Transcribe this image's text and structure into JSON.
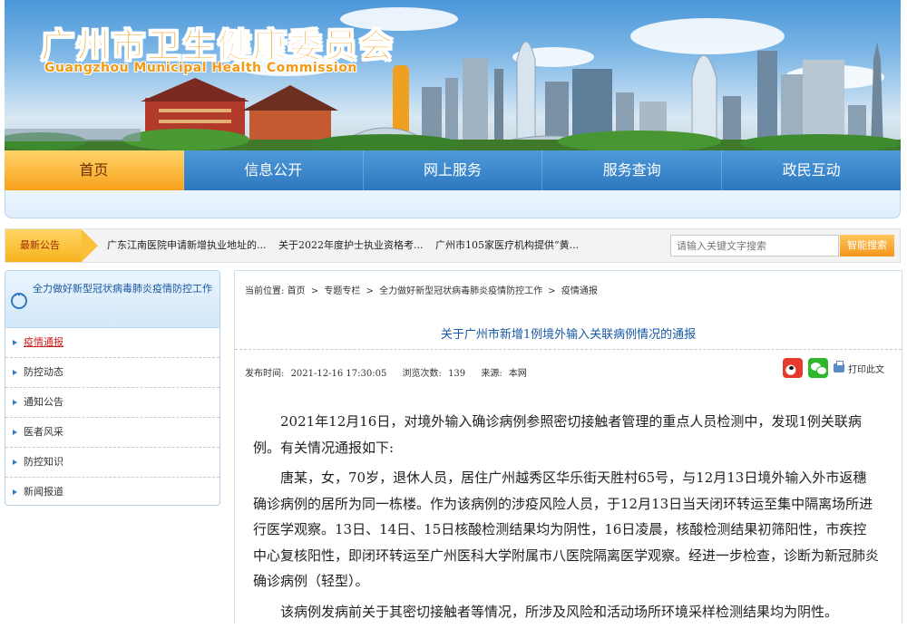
{
  "header": {
    "title_cn": "广州市卫生健康委员会",
    "title_en": "Guangzhou Municipal Health Commission"
  },
  "nav": {
    "items": [
      "首页",
      "信息公开",
      "网上服务",
      "服务查询",
      "政民互动"
    ],
    "active": "首页"
  },
  "notice": {
    "label": "最新公告",
    "links": [
      "广东江南医院申请新增执业地址的...",
      "关于2022年度护士执业资格考...",
      "广州市105家医疗机构提供“黄..."
    ]
  },
  "search": {
    "placeholder": "请输入关键文字搜索",
    "button": "智能搜索"
  },
  "sidebar": {
    "title": "全力做好新型冠状病毒肺炎疫情防控工作",
    "items": [
      "疫情通报",
      "防控动态",
      "通知公告",
      "医者风采",
      "防控知识",
      "新闻报道"
    ],
    "active": "疫情通报"
  },
  "breadcrumb": {
    "prefix": "当前位置:",
    "items": [
      "首页",
      "专题专栏",
      "全力做好新型冠状病毒肺炎疫情防控工作",
      "疫情通报"
    ],
    "separator": ">"
  },
  "article": {
    "title": "关于广州市新增1例境外输入关联病例情况的通报",
    "publish_label": "发布时间:",
    "publish_time": "2021-12-16 17:30:05",
    "views_label": "浏览次数:",
    "views": "139",
    "source_label": "来源:",
    "source": "本网",
    "print_label": "打印此文",
    "paragraphs": [
      "2021年12月16日，对境外输入确诊病例参照密切接触者管理的重点人员检测中，发现1例关联病例。有关情况通报如下:",
      "唐某，女，70岁，退休人员，居住广州越秀区华乐街天胜村65号，与12月13日境外输入外市返穗确诊病例的居所为同一栋楼。作为该病例的涉疫风险人员，于12月13日当天闭环转运至集中隔离场所进行医学观察。13日、14日、15日核酸检测结果均为阴性，16日凌晨，核酸检测结果初筛阳性，市疾控中心复核阳性，即闭环转运至广州医科大学附属市八医院隔离医学观察。经进一步检查，诊断为新冠肺炎确诊病例（轻型）。",
      "该病例发病前关于其密切接触者等情况，所涉及风险和活动场所环境采样检测结果均为阴性。"
    ]
  },
  "colors": {
    "nav_blue": "#2e77c0",
    "nav_active": "#f7a11a",
    "title_blue": "#1659a6",
    "active_red": "#c9201e",
    "brand_orange": "#f29a12"
  }
}
